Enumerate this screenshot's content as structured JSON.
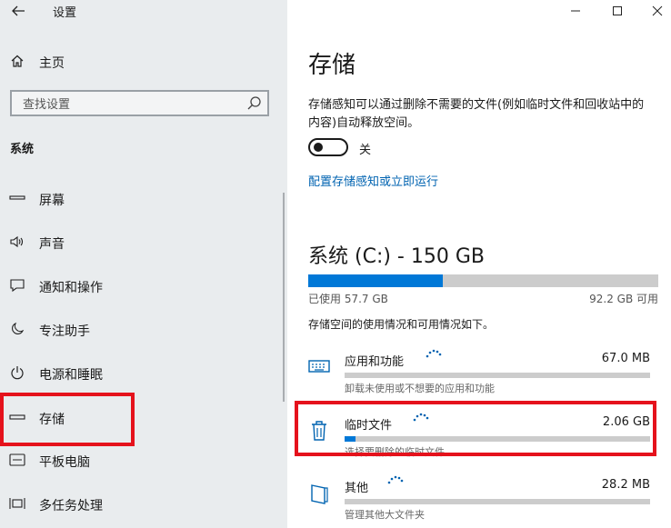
{
  "window": {
    "title": "设置",
    "back_icon": "arrow-left-icon",
    "controls": [
      "minimize-icon",
      "maximize-icon",
      "close-icon"
    ]
  },
  "sidebar": {
    "home_label": "主页",
    "search_placeholder": "查找设置",
    "section": "系统",
    "items": [
      {
        "label": "屏幕",
        "icon": "display-icon"
      },
      {
        "label": "声音",
        "icon": "speaker-icon"
      },
      {
        "label": "通知和操作",
        "icon": "notification-icon"
      },
      {
        "label": "专注助手",
        "icon": "moon-icon"
      },
      {
        "label": "电源和睡眠",
        "icon": "power-icon"
      },
      {
        "label": "存储",
        "icon": "storage-icon"
      },
      {
        "label": "平板电脑",
        "icon": "tablet-icon"
      },
      {
        "label": "多任务处理",
        "icon": "multitask-icon"
      }
    ]
  },
  "main": {
    "title": "存储",
    "description": "存储感知可以通过删除不需要的文件(例如临时文件和回收站中的内容)自动释放空间。",
    "toggle_state": "关",
    "toggle_on": false,
    "link": "配置存储感知或立即运行",
    "drive_title": "系统 (C:) - 150 GB",
    "used": "已使用 57.7 GB",
    "available": "92.2 GB 可用",
    "used_fraction": 0.385,
    "usage_desc": "存储空间的使用情况和可用情况如下。",
    "categories": [
      {
        "name": "应用和功能",
        "size": "67.0 MB",
        "desc": "卸载未使用或不想要的应用和功能",
        "fraction": 0.0,
        "icon": "apps-icon"
      },
      {
        "name": "临时文件",
        "size": "2.06 GB",
        "desc": "选择要删除的临时文件",
        "fraction": 0.035,
        "icon": "trash-icon"
      },
      {
        "name": "其他",
        "size": "28.2 MB",
        "desc": "管理其他大文件夹",
        "fraction": 0.0,
        "icon": "folder-icon"
      }
    ]
  },
  "colors": {
    "accent": "#0078d7",
    "highlight_box": "#e5121c",
    "sidebar_bg": "#e9ecee",
    "link": "#0063b1"
  }
}
